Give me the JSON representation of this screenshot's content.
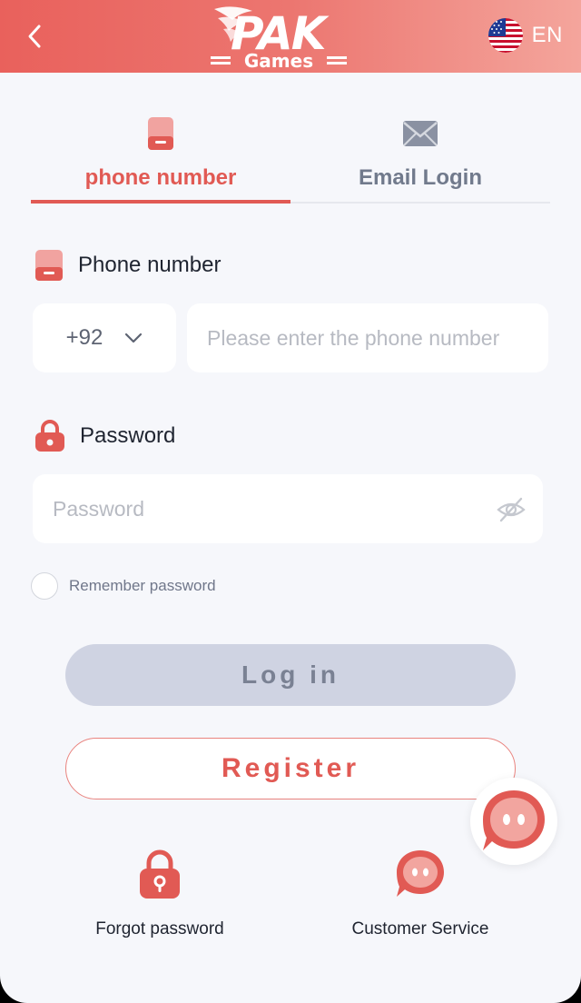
{
  "header": {
    "logo_text": "PAK",
    "logo_sub": "Games",
    "language": "EN"
  },
  "tabs": [
    {
      "label": "phone number",
      "active": true
    },
    {
      "label": "Email Login",
      "active": false
    }
  ],
  "phone": {
    "label": "Phone number",
    "country_code": "+92",
    "placeholder": "Please enter the phone number"
  },
  "password": {
    "label": "Password",
    "placeholder": "Password"
  },
  "remember_label": "Remember password",
  "login_label": "Log in",
  "register_label": "Register",
  "links": {
    "forgot": "Forgot password",
    "service": "Customer Service"
  },
  "colors": {
    "accent": "#e15a54",
    "header_start": "#e9615c",
    "header_end": "#f4a59c",
    "login_bg": "#cfd3e2",
    "background": "#f6f7fb"
  },
  "icons": [
    "back-arrow-icon",
    "us-flag-icon",
    "phone-icon",
    "mail-icon",
    "lock-icon",
    "eye-off-icon",
    "chevron-down-icon",
    "customer-service-icon"
  ]
}
